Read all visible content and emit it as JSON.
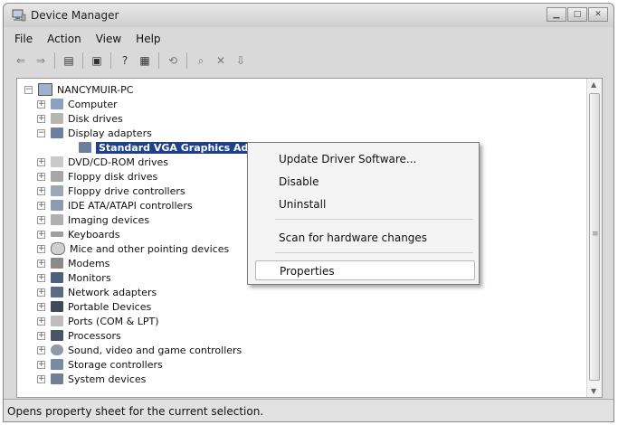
{
  "window": {
    "title": "Device Manager"
  },
  "menubar": [
    "File",
    "Action",
    "View",
    "Help"
  ],
  "toolbar": [
    {
      "icon": "back-arrow-icon",
      "glyph": "⇐"
    },
    {
      "icon": "forward-arrow-icon",
      "glyph": "⇒"
    },
    {
      "icon": "show-hide-tree-icon",
      "glyph": "▤"
    },
    {
      "icon": "properties-icon",
      "glyph": "▣"
    },
    {
      "icon": "help-icon",
      "glyph": "?"
    },
    {
      "icon": "view-icon",
      "glyph": "▦"
    },
    {
      "icon": "update-driver-icon",
      "glyph": "⟲"
    },
    {
      "icon": "scan-hardware-icon",
      "glyph": "⌕"
    },
    {
      "icon": "uninstall-icon",
      "glyph": "✕"
    },
    {
      "icon": "disable-icon",
      "glyph": "⇩"
    }
  ],
  "tree": {
    "root": "NANCYMUIR-PC",
    "items": [
      {
        "label": "Computer",
        "icon": "computer-icon",
        "expander": "+"
      },
      {
        "label": "Disk drives",
        "icon": "disk-drive-icon",
        "expander": "+"
      },
      {
        "label": "Display adapters",
        "icon": "display-adapter-icon",
        "expander": "−"
      },
      {
        "label": "Standard VGA Graphics Adapter",
        "icon": "display-adapter-icon",
        "expander": "",
        "selected": true
      },
      {
        "label": "DVD/CD-ROM drives",
        "icon": "dvd-drive-icon",
        "expander": "+"
      },
      {
        "label": "Floppy disk drives",
        "icon": "floppy-drive-icon",
        "expander": "+"
      },
      {
        "label": "Floppy drive controllers",
        "icon": "floppy-controller-icon",
        "expander": "+"
      },
      {
        "label": "IDE ATA/ATAPI controllers",
        "icon": "ide-controller-icon",
        "expander": "+"
      },
      {
        "label": "Imaging devices",
        "icon": "imaging-device-icon",
        "expander": "+"
      },
      {
        "label": "Keyboards",
        "icon": "keyboard-icon",
        "expander": "+"
      },
      {
        "label": "Mice and other pointing devices",
        "icon": "mouse-icon",
        "expander": "+"
      },
      {
        "label": "Modems",
        "icon": "modem-icon",
        "expander": "+"
      },
      {
        "label": "Monitors",
        "icon": "monitor-icon",
        "expander": "+"
      },
      {
        "label": "Network adapters",
        "icon": "network-adapter-icon",
        "expander": "+"
      },
      {
        "label": "Portable Devices",
        "icon": "portable-device-icon",
        "expander": "+"
      },
      {
        "label": "Ports (COM & LPT)",
        "icon": "port-icon",
        "expander": "+"
      },
      {
        "label": "Processors",
        "icon": "processor-icon",
        "expander": "+"
      },
      {
        "label": "Sound, video and game controllers",
        "icon": "sound-icon",
        "expander": "+"
      },
      {
        "label": "Storage controllers",
        "icon": "storage-controller-icon",
        "expander": "+"
      },
      {
        "label": "System devices",
        "icon": "system-device-icon",
        "expander": "+"
      }
    ]
  },
  "context_menu": [
    "Update Driver Software...",
    "Disable",
    "Uninstall",
    "Scan for hardware changes",
    "Properties"
  ],
  "status_bar": "Opens property sheet for the current selection.",
  "colors": {
    "selection": "#1f3f8f",
    "window_chrome": "#d9d9d9"
  }
}
